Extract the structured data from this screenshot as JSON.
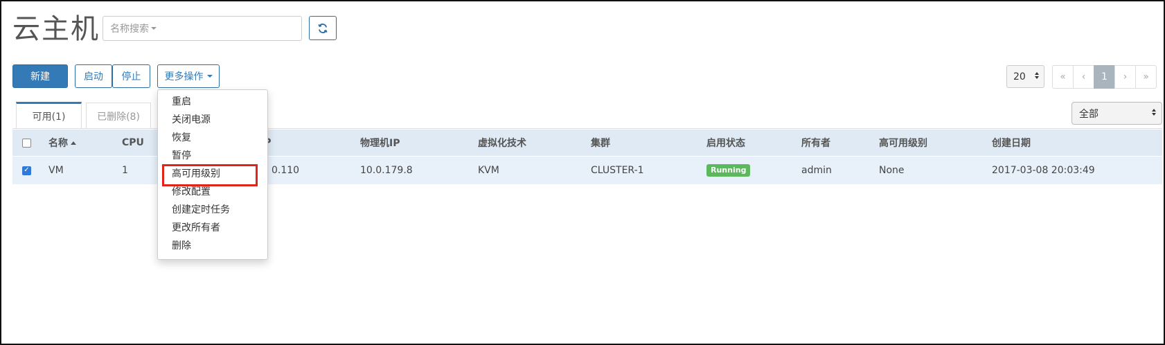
{
  "page": {
    "title": "云主机"
  },
  "search": {
    "placeholder": "名称搜索"
  },
  "toolbar": {
    "new_label": "新建",
    "start_label": "启动",
    "stop_label": "停止",
    "more_label": "更多操作"
  },
  "more_menu": {
    "items": [
      "重启",
      "关闭电源",
      "恢复",
      "暂停",
      "高可用级别",
      "修改配置",
      "创建定时任务",
      "更改所有者",
      "删除"
    ],
    "highlighted": "高可用级别"
  },
  "tabs": [
    {
      "label": "可用(1)",
      "active": true
    },
    {
      "label": "已删除(8)",
      "active": false
    }
  ],
  "filter": {
    "value": "全部"
  },
  "pagination": {
    "page_size": "20",
    "first": "«",
    "prev": "‹",
    "current": "1",
    "next": "›",
    "last": "»"
  },
  "table": {
    "headers": {
      "name": "名称",
      "cpu": "CPU",
      "ip": "IP",
      "host_ip": "物理机IP",
      "virt": "虚拟化技术",
      "cluster": "集群",
      "status": "启用状态",
      "owner": "所有者",
      "ha_level": "高可用级别",
      "created": "创建日期"
    },
    "rows": [
      {
        "checked": true,
        "name": "VM",
        "cpu": "1",
        "ip": "0.110",
        "host_ip": "10.0.179.8",
        "virt": "KVM",
        "cluster": "CLUSTER-1",
        "status": "Running",
        "owner": "admin",
        "ha_level": "None",
        "created": "2017-03-08 20:03:49"
      }
    ]
  },
  "colors": {
    "primary": "#337ab7",
    "header_bg": "#dfeaf5",
    "row_bg": "#e8f1fa",
    "running_badge": "#5cb85c",
    "highlight_border": "#e0231b"
  },
  "icons": {
    "refresh": "refresh-icon",
    "checkbox_check": "check-icon"
  }
}
